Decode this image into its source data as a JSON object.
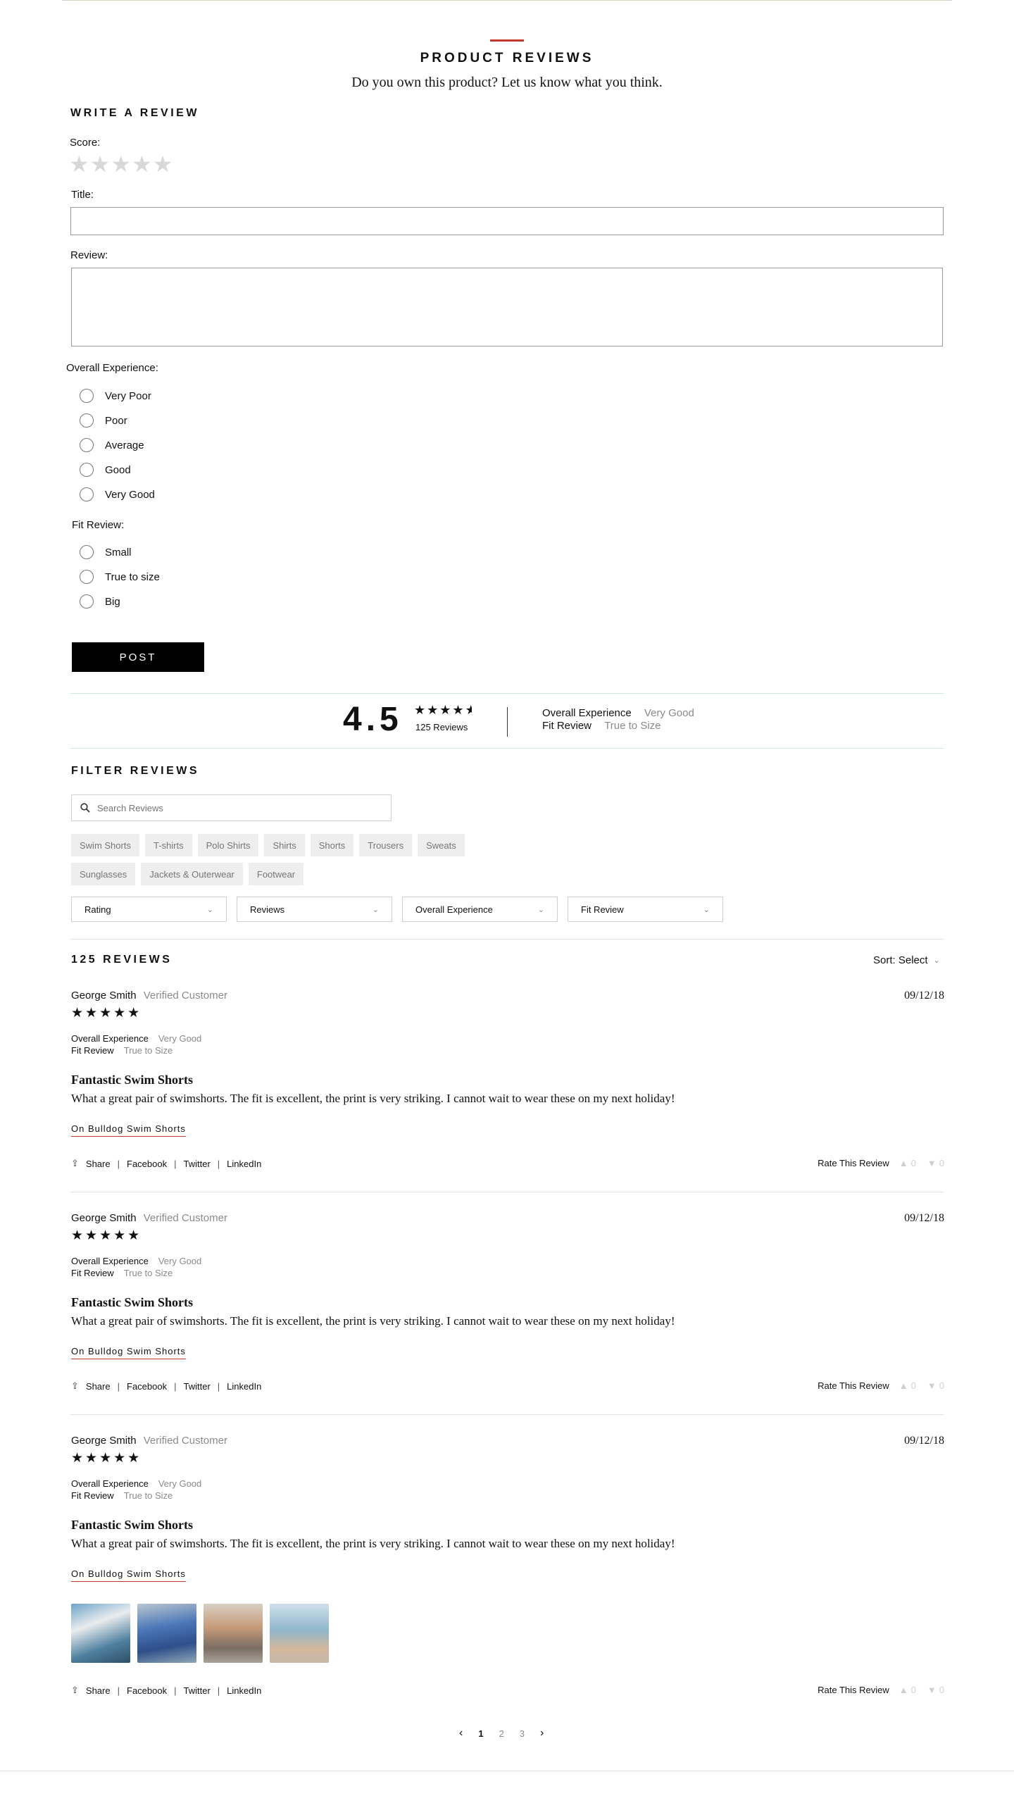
{
  "header": {
    "title": "PRODUCT REVIEWS",
    "subtitle": "Do you own this product? Let us know what you think."
  },
  "write_review": {
    "heading": "WRITE A REVIEW",
    "score_label": "Score:",
    "title_label": "Title:",
    "title_value": "",
    "review_label": "Review:",
    "review_value": "",
    "overall_label": "Overall Experience:",
    "overall_options": [
      "Very Poor",
      "Poor",
      "Average",
      "Good",
      "Very Good"
    ],
    "fit_label": "Fit Review:",
    "fit_options": [
      "Small",
      "True to size",
      "Big"
    ],
    "post_label": "POST"
  },
  "summary": {
    "rating": "4.5",
    "stars_value": 4.5,
    "review_count": "125 Reviews",
    "overall_label": "Overall Experience",
    "overall_value": "Very Good",
    "fit_label": "Fit Review",
    "fit_value": "True to Size"
  },
  "filter": {
    "heading": "FILTER REVIEWS",
    "search_placeholder": "Search Reviews",
    "chips_row1": [
      "Swim Shorts",
      "T-shirts",
      "Polo Shirts",
      "Shirts",
      "Shorts",
      "Trousers",
      "Sweats"
    ],
    "chips_row2": [
      "Sunglasses",
      "Jackets & Outerwear",
      "Footwear"
    ],
    "dropdowns": [
      "Rating",
      "Reviews",
      "Overall Experience",
      "Fit Review"
    ]
  },
  "reviews_list": {
    "count_heading": "125 REVIEWS",
    "sort_label": "Sort: Select",
    "items": [
      {
        "author": "George Smith",
        "badge": "Verified Customer",
        "date": "09/12/18",
        "stars": 5,
        "overall_label": "Overall Experience",
        "overall_value": "Very Good",
        "fit_label": "Fit Review",
        "fit_value": "True to Size",
        "title": "Fantastic Swim Shorts",
        "body": "What a great pair of swimshorts. The fit is excellent, the print is very striking. I cannot wait to wear these on my next holiday!",
        "product_link": "On Bulldog Swim Shorts",
        "has_photos": false
      },
      {
        "author": "George Smith",
        "badge": "Verified Customer",
        "date": "09/12/18",
        "stars": 5,
        "overall_label": "Overall Experience",
        "overall_value": "Very Good",
        "fit_label": "Fit Review",
        "fit_value": "True to Size",
        "title": "Fantastic Swim Shorts",
        "body": "What a great pair of swimshorts. The fit is excellent, the print is very striking. I cannot wait to wear these on my next holiday!",
        "product_link": "On Bulldog Swim Shorts",
        "has_photos": false
      },
      {
        "author": "George Smith",
        "badge": "Verified Customer",
        "date": "09/12/18",
        "stars": 5,
        "overall_label": "Overall Experience",
        "overall_value": "Very Good",
        "fit_label": "Fit Review",
        "fit_value": "True to Size",
        "title": "Fantastic Swim Shorts",
        "body": "What a great pair of swimshorts. The fit is excellent, the print is very striking. I cannot wait to wear these on my next holiday!",
        "product_link": "On Bulldog Swim Shorts",
        "has_photos": true
      }
    ],
    "share": {
      "share_label": "Share",
      "facebook": "Facebook",
      "twitter": "Twitter",
      "linkedin": "LinkedIn"
    },
    "rate_label": "Rate This Review",
    "thumbs_up_count": "0",
    "thumbs_down_count": "0"
  },
  "pagination": {
    "pages": [
      "1",
      "2",
      "3"
    ],
    "current": "1"
  },
  "colors": {
    "accent": "#c0392b",
    "divider_teal": "#cfe3e3",
    "chip_bg": "#eeeeee",
    "muted_text": "#8a8a8a"
  }
}
